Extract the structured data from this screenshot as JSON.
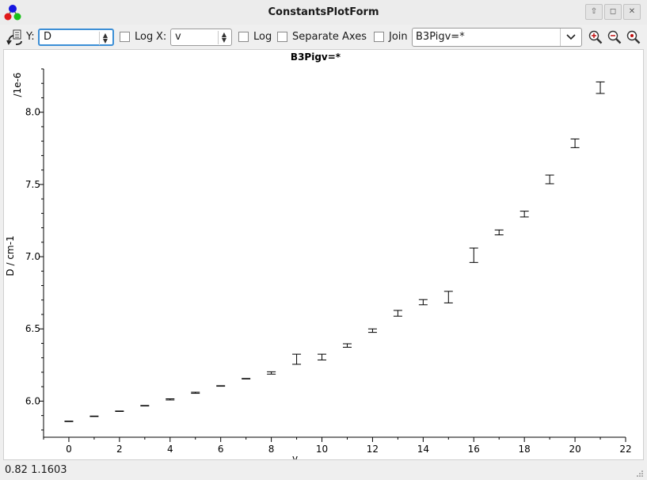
{
  "window": {
    "title": "ConstantsPlotForm"
  },
  "toolbar": {
    "y_label": "Y:",
    "y_value": "D",
    "log_y_label": "Log",
    "x_label": "X:",
    "x_value": "v",
    "log_x_label": "Log",
    "separate_axes_label": "Separate Axes",
    "join_label": "Join",
    "filter_value": "B3Pigv=*"
  },
  "chart_data": {
    "type": "scatter",
    "title": "B3Pigv=*",
    "xlabel": "v",
    "ylabel": "D / cm-1",
    "y_multiplier_label": "/1e-6",
    "xlim": [
      -1,
      22
    ],
    "ylim": [
      5.75,
      8.3
    ],
    "x_ticks": [
      "0",
      "2",
      "4",
      "6",
      "8",
      "10",
      "12",
      "14",
      "16",
      "18",
      "20",
      "22"
    ],
    "y_ticks": [
      "6.0",
      "6.5",
      "7.0",
      "7.5",
      "8.0"
    ],
    "series": [
      {
        "points": [
          {
            "x": 0,
            "y": 5.86,
            "err": 0.002
          },
          {
            "x": 1,
            "y": 5.895,
            "err": 0.002
          },
          {
            "x": 2,
            "y": 5.93,
            "err": 0.002
          },
          {
            "x": 3,
            "y": 5.968,
            "err": 0.003
          },
          {
            "x": 4,
            "y": 6.012,
            "err": 0.004
          },
          {
            "x": 5,
            "y": 6.058,
            "err": 0.004
          },
          {
            "x": 6,
            "y": 6.105,
            "err": 0.003
          },
          {
            "x": 7,
            "y": 6.155,
            "err": 0.003
          },
          {
            "x": 8,
            "y": 6.195,
            "err": 0.008
          },
          {
            "x": 9,
            "y": 6.29,
            "err": 0.035
          },
          {
            "x": 10,
            "y": 6.305,
            "err": 0.02
          },
          {
            "x": 11,
            "y": 6.385,
            "err": 0.012
          },
          {
            "x": 12,
            "y": 6.488,
            "err": 0.012
          },
          {
            "x": 13,
            "y": 6.608,
            "err": 0.02
          },
          {
            "x": 14,
            "y": 6.685,
            "err": 0.018
          },
          {
            "x": 15,
            "y": 6.72,
            "err": 0.04
          },
          {
            "x": 16,
            "y": 7.01,
            "err": 0.05
          },
          {
            "x": 17,
            "y": 7.168,
            "err": 0.017
          },
          {
            "x": 18,
            "y": 7.295,
            "err": 0.02
          },
          {
            "x": 19,
            "y": 7.535,
            "err": 0.03
          },
          {
            "x": 20,
            "y": 7.785,
            "err": 0.03
          },
          {
            "x": 21,
            "y": 8.17,
            "err": 0.04
          }
        ]
      }
    ]
  },
  "status": {
    "coordinates": "0.82  1.1603"
  }
}
